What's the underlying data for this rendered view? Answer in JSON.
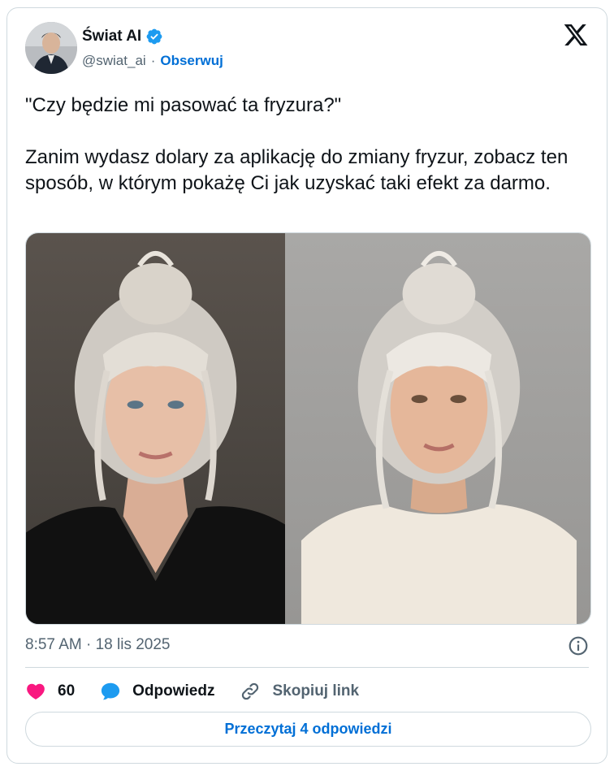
{
  "author": {
    "display_name": "Świat AI",
    "handle": "@swiat_ai",
    "separator": "·",
    "follow_label": "Obserwuj",
    "verified_color": "#1d9bf0"
  },
  "tweet": {
    "text": "\"Czy będzie mi pasować ta fryzura?\"\n\nZanim wydasz dolary za aplikację do zmiany fryzur, zobacz ten sposób, w którym pokażę Ci jak uzyskać taki efekt za darmo.",
    "timestamp": "8:57 AM · 18 lis 2025",
    "media": [
      {
        "description": "woman-silver-hair-bun-black-top"
      },
      {
        "description": "woman-platinum-hair-bun-white-top"
      }
    ]
  },
  "actions": {
    "likes_count": "60",
    "reply_label": "Odpowiedz",
    "copy_link_label": "Skopiuj link",
    "read_replies_label": "Przeczytaj 4 odpowiedzi",
    "like_color": "#f91880",
    "reply_color": "#1d9bf0"
  },
  "colors": {
    "accent": "#006fd6",
    "text_primary": "#0f1419",
    "text_secondary": "#536471",
    "border": "#cfd9de"
  }
}
